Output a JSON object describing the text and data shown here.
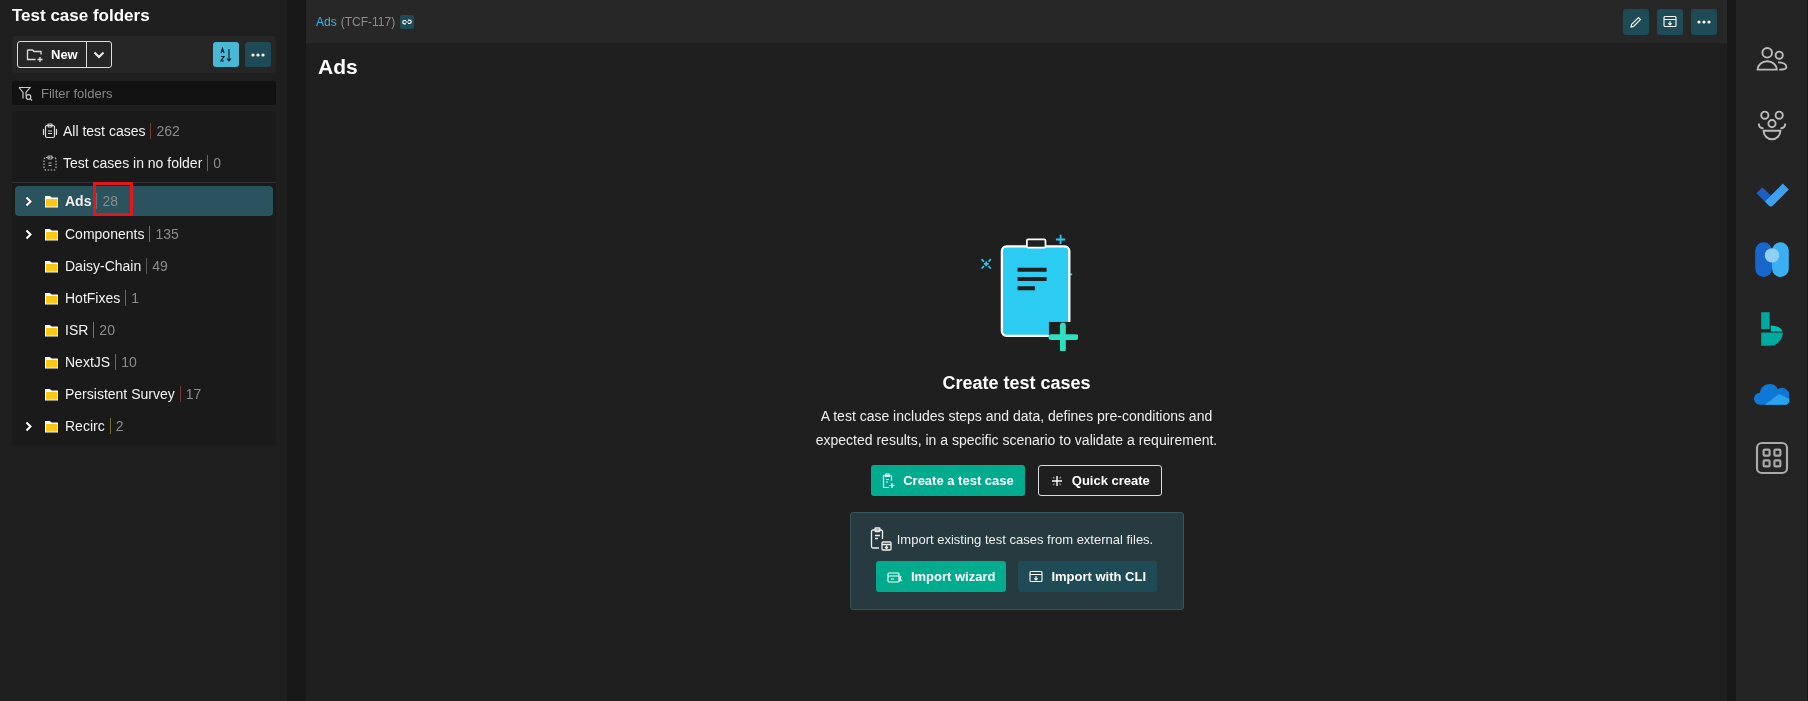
{
  "sidebar": {
    "title": "Test case folders",
    "new_button": "New",
    "filter": {
      "placeholder": "Filter folders"
    },
    "special_items": [
      {
        "kind": "all",
        "label": "All test cases",
        "count": "262",
        "color": "#7a3a3a"
      },
      {
        "kind": "unfiled",
        "label": "Test cases in no folder",
        "count": "0",
        "color": "#7a6a30"
      }
    ],
    "folders": [
      {
        "name": "Ads",
        "count": "28",
        "color": "#5d7177",
        "selected": true,
        "expandable": true,
        "highlighted": true
      },
      {
        "name": "Components",
        "count": "135",
        "color": "#8a6d3b",
        "selected": false,
        "expandable": true,
        "highlighted": false
      },
      {
        "name": "Daisy-Chain",
        "count": "49",
        "color": "#5a5a5a",
        "selected": false,
        "expandable": false,
        "highlighted": false
      },
      {
        "name": "HotFixes",
        "count": "1",
        "color": "#7a6a30",
        "selected": false,
        "expandable": false,
        "highlighted": false
      },
      {
        "name": "ISR",
        "count": "20",
        "color": "#8a7a30",
        "selected": false,
        "expandable": false,
        "highlighted": false
      },
      {
        "name": "NextJS",
        "count": "10",
        "color": "#7a6a30",
        "selected": false,
        "expandable": false,
        "highlighted": false
      },
      {
        "name": "Persistent Survey",
        "count": "17",
        "color": "#7a3a3a",
        "selected": false,
        "expandable": false,
        "highlighted": false
      },
      {
        "name": "Recirc",
        "count": "2",
        "color": "#7a6a30",
        "selected": false,
        "expandable": true,
        "highlighted": false
      }
    ]
  },
  "header": {
    "breadcrumb": "Ads",
    "key": "(TCF-117)"
  },
  "page": {
    "title": "Ads",
    "empty_state": {
      "heading": "Create test cases",
      "description": "A test case includes steps and data, defines pre-conditions and expected results, in a specific scenario to validate a requirement.",
      "buttons": [
        {
          "label": "Create a test case",
          "kind": "primary"
        },
        {
          "label": "Quick create",
          "kind": "outline"
        }
      ],
      "import": {
        "text": "Import existing test cases from external files.",
        "buttons": [
          {
            "label": "Import wizard",
            "kind": "primary"
          },
          {
            "label": "Import with CLI",
            "kind": "secondary"
          }
        ]
      }
    }
  }
}
